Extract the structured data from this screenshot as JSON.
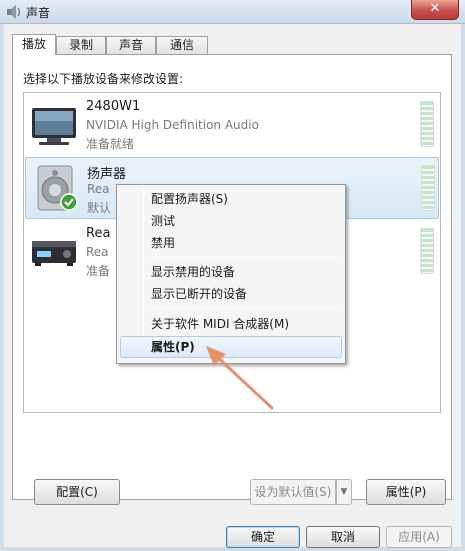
{
  "window": {
    "title": "声音",
    "close_glyph": "✕"
  },
  "tabs": [
    {
      "label": "播放",
      "active": true
    },
    {
      "label": "录制",
      "active": false
    },
    {
      "label": "声音",
      "active": false
    },
    {
      "label": "通信",
      "active": false
    }
  ],
  "instruction": "选择以下播放设备来修改设置:",
  "devices": [
    {
      "name": "2480W1",
      "description": "NVIDIA High Definition Audio",
      "status": "准备就绪",
      "icon": "monitor-icon",
      "selected": false
    },
    {
      "name": "扬声器",
      "description": "Rea",
      "status": "默认",
      "icon": "speaker-icon",
      "selected": true
    },
    {
      "name": "Rea",
      "description": "Rea",
      "status": "准备",
      "icon": "digital-output-icon",
      "selected": false
    }
  ],
  "context_menu": {
    "items": [
      {
        "label": "配置扬声器(S)"
      },
      {
        "label": "测试"
      },
      {
        "label": "禁用"
      },
      {
        "label": "显示禁用的设备"
      },
      {
        "label": "显示已断开的设备"
      },
      {
        "label": "关于软件 MIDI 合成器(M)"
      },
      {
        "label": "属性(P)",
        "highlighted": true
      }
    ]
  },
  "panel_buttons": {
    "configure": "配置(C)",
    "set_default": "设为默认值(S)",
    "properties": "属性(P)"
  },
  "dialog_buttons": {
    "ok": "确定",
    "cancel": "取消",
    "apply": "应用(A)"
  },
  "colors": {
    "annotation_arrow": "#e8906a",
    "selection": "#d7e8f7",
    "accent": "#3c7fb1"
  }
}
